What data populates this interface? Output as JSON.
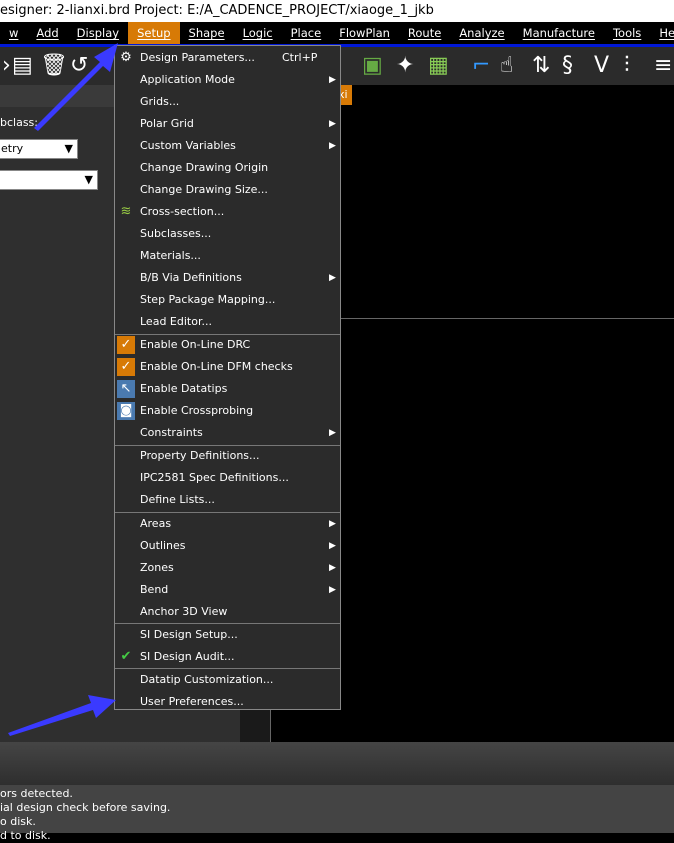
{
  "title": "esigner: 2-lianxi.brd  Project: E:/A_CADENCE_PROJECT/xiaoge_1_jkb",
  "menubar": [
    "w",
    "Add",
    "Display",
    "Setup",
    "Shape",
    "Logic",
    "Place",
    "FlowPlan",
    "Route",
    "Analyze",
    "Manufacture",
    "Tools",
    "Help"
  ],
  "active_menu": "Setup",
  "left_panel": {
    "label": "bclass:",
    "select1": "etry",
    "select2": ""
  },
  "tab_label": "xi",
  "menu_items": [
    {
      "label": "Design Parameters...",
      "shortcut": "Ctrl+P",
      "icon": "gear"
    },
    {
      "label": "Application Mode",
      "submenu": true
    },
    {
      "label": "Grids..."
    },
    {
      "label": "Polar Grid",
      "submenu": true
    },
    {
      "label": "Custom Variables",
      "submenu": true
    },
    {
      "label": "Change Drawing Origin"
    },
    {
      "label": "Change Drawing Size..."
    },
    {
      "label": "Cross-section...",
      "icon": "layers"
    },
    {
      "label": "Subclasses..."
    },
    {
      "label": "Materials..."
    },
    {
      "label": "B/B Via Definitions",
      "submenu": true
    },
    {
      "label": "Step Package Mapping..."
    },
    {
      "label": "Lead Editor...",
      "sep_after": true
    },
    {
      "label": "Enable On-Line DRC",
      "icon": "check"
    },
    {
      "label": "Enable On-Line DFM checks",
      "icon": "check"
    },
    {
      "label": "Enable Datatips",
      "icon": "datatip"
    },
    {
      "label": "Enable Crossprobing",
      "icon": "crossprobe"
    },
    {
      "label": "Constraints",
      "submenu": true,
      "sep_after": true
    },
    {
      "label": "Property Definitions..."
    },
    {
      "label": "IPC2581 Spec Definitions..."
    },
    {
      "label": "Define Lists...",
      "sep_after": true
    },
    {
      "label": "Areas",
      "submenu": true
    },
    {
      "label": "Outlines",
      "submenu": true
    },
    {
      "label": "Zones",
      "submenu": true
    },
    {
      "label": "Bend",
      "submenu": true
    },
    {
      "label": "Anchor 3D View",
      "sep_after": true
    },
    {
      "label": "SI Design Setup..."
    },
    {
      "label": "SI Design Audit...",
      "icon": "audit",
      "sep_after": true
    },
    {
      "label": "Datatip Customization..."
    },
    {
      "label": "User Preferences..."
    }
  ],
  "console": [
    "ors detected.",
    "ial design check before saving.",
    "o disk.",
    "d to disk."
  ],
  "colors": {
    "accent": "#d77a06",
    "menubar_line": "#0018d8",
    "arrow": "#3a3aff"
  }
}
